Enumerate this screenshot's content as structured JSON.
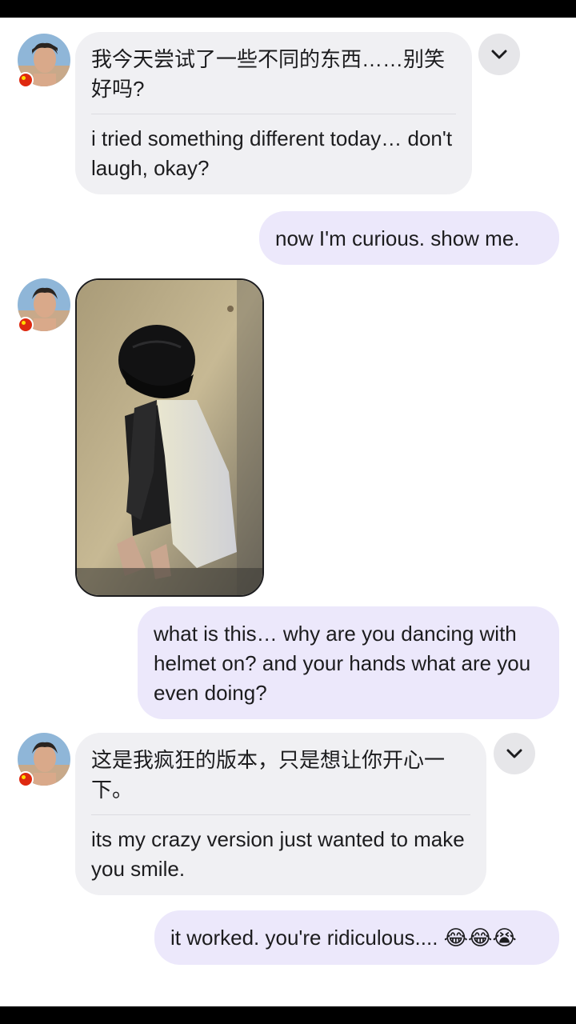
{
  "messages": {
    "m1": {
      "zh": "我今天尝试了一些不同的东西……别笑好吗?",
      "en": "i tried something different today… don't laugh, okay?"
    },
    "m2": {
      "text": "now I'm curious. show me."
    },
    "m3": {
      "media_type": "photo"
    },
    "m4": {
      "text": "what is this… why are you dancing with helmet on? and your hands what are you even doing?"
    },
    "m5": {
      "zh": "这是我疯狂的版本，只是想让你开心一下。",
      "en": "its my crazy version just wanted to make you smile."
    },
    "m6": {
      "text": "it worked. you're ridiculous.... ",
      "emoji": "😂😂😭"
    }
  },
  "icons": {
    "translate_toggle": "chevron-down-icon",
    "contact_flag": "china-flag-icon"
  },
  "colors": {
    "incoming_bubble": "#f0f0f3",
    "outgoing_bubble": "#ece8fb",
    "text": "#1c1c1e",
    "divider": "#dcdce0"
  }
}
